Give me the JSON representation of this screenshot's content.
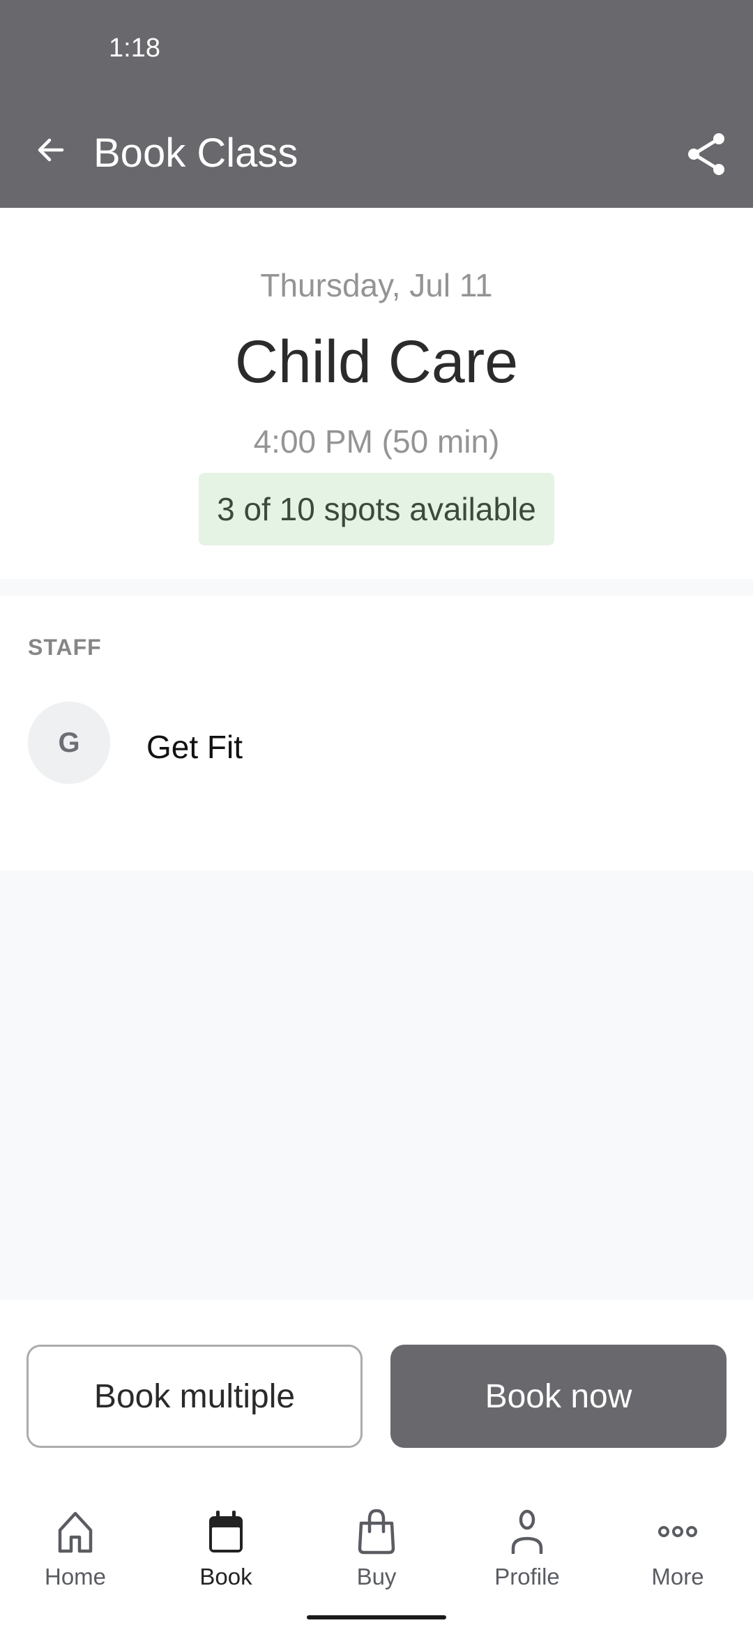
{
  "status_bar": {
    "time": "1:18"
  },
  "app_bar": {
    "title": "Book Class",
    "back_icon": "arrow-left-icon",
    "share_icon": "share-icon",
    "background_color": "#69686d"
  },
  "class_info": {
    "date": "Thursday, Jul 11",
    "name": "Child Care",
    "time": "4:00 PM (50 min)",
    "availability": "3 of 10 spots available",
    "availability_color": "#e5f3e4"
  },
  "staff": {
    "section_label": "STAFF",
    "members": [
      {
        "initial": "G",
        "name": "Get Fit"
      }
    ]
  },
  "actions": {
    "book_multiple_label": "Book multiple",
    "book_now_label": "Book now"
  },
  "tab_bar": {
    "active": "Book",
    "items": [
      {
        "label": "Home",
        "icon": "home-icon"
      },
      {
        "label": "Book",
        "icon": "calendar-icon"
      },
      {
        "label": "Buy",
        "icon": "shopping-bag-icon"
      },
      {
        "label": "Profile",
        "icon": "person-icon"
      },
      {
        "label": "More",
        "icon": "more-dots-icon"
      }
    ]
  }
}
